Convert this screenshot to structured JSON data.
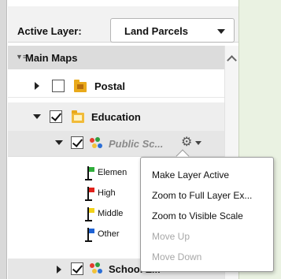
{
  "active_layer": {
    "label": "Active Layer:",
    "selected": "Land Parcels"
  },
  "tree": {
    "group_title": "Main Maps",
    "postal_label": "Postal",
    "education_label": "Education",
    "public_label": "Public Sc...",
    "school_label": "School Z...",
    "legend": [
      {
        "label": "Elemen",
        "color": "#2fae3b"
      },
      {
        "label": "High",
        "color": "#e0211b"
      },
      {
        "label": "Middle",
        "color": "#f2d21a"
      },
      {
        "label": "Other",
        "color": "#1e62d4"
      }
    ]
  },
  "context_menu": {
    "items": [
      {
        "label": "Make Layer Active",
        "enabled": true
      },
      {
        "label": "Zoom to Full Layer Ex...",
        "enabled": true
      },
      {
        "label": "Zoom to Visible Scale",
        "enabled": true
      },
      {
        "label": "Move Up",
        "enabled": false
      },
      {
        "label": "Move Down",
        "enabled": false
      }
    ]
  },
  "colors": {
    "map_background": "#eaf2e2",
    "folder": "#e9a91a"
  }
}
